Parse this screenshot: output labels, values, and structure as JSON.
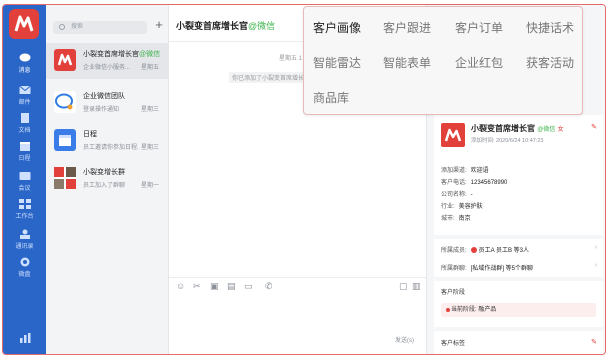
{
  "sidebar": {
    "items": [
      {
        "label": "消息",
        "icon": "chat-bubble-icon"
      },
      {
        "label": "邮件",
        "icon": "mail-icon"
      },
      {
        "label": "文档",
        "icon": "document-icon"
      },
      {
        "label": "日程",
        "icon": "calendar-icon"
      },
      {
        "label": "会议",
        "icon": "meeting-icon"
      },
      {
        "label": "工作台",
        "icon": "workbench-icon"
      },
      {
        "label": "通讯录",
        "icon": "contacts-icon"
      },
      {
        "label": "微盘",
        "icon": "drive-icon"
      }
    ]
  },
  "list": {
    "search_placeholder": "搜索",
    "add_label": "+",
    "conversations": [
      {
        "name": "小裂变首席增长官",
        "tag": "@微信",
        "sub": "企业微信小服务...",
        "time": "星期五"
      },
      {
        "name": "企业微信团队",
        "tag": "",
        "sub": "登录操作通知",
        "time": "星期三"
      },
      {
        "name": "日程",
        "tag": "",
        "sub": "员工邀请你参加日程...",
        "time": "星期三"
      },
      {
        "name": "小裂变增长群",
        "tag": "",
        "sub": "员工加入了群聊",
        "time": "星期一"
      }
    ]
  },
  "chat": {
    "title": "小裂变首席增长官",
    "title_tag": "@微信",
    "timestamp": "星期五 1",
    "system_msg": "你已添加了小裂变首席增长",
    "send_label": "发送(s)"
  },
  "popover": {
    "rows": [
      [
        "客户画像",
        "客户跟进",
        "客户订单",
        "快捷话术"
      ],
      [
        "智能雷达",
        "智能表单",
        "企业红包",
        "获客活动"
      ],
      [
        "商品库"
      ]
    ]
  },
  "profile": {
    "name": "小裂变首席增长官",
    "tag": "@微信",
    "gender": "女",
    "added_time": "添加时间: 2020/6/24 10:47:23",
    "fields": [
      {
        "label": "添加渠道:",
        "value": "欢迎语"
      },
      {
        "label": "客户电话:",
        "value": "12345678990"
      },
      {
        "label": "公司名称:",
        "value": "-"
      },
      {
        "label": "行业:",
        "value": "美容护肤"
      },
      {
        "label": "城市:",
        "value": "南京"
      }
    ],
    "owners_label": "所属成员:",
    "owners_value": "员工A   员工B 等3人",
    "groups_label": "所属群聊:",
    "groups_value": "[私域作战群] 等5个群聊",
    "stage_title": "客户阶段",
    "stage_current": "当前阶段: 融产品",
    "tags_title": "客户标签"
  }
}
